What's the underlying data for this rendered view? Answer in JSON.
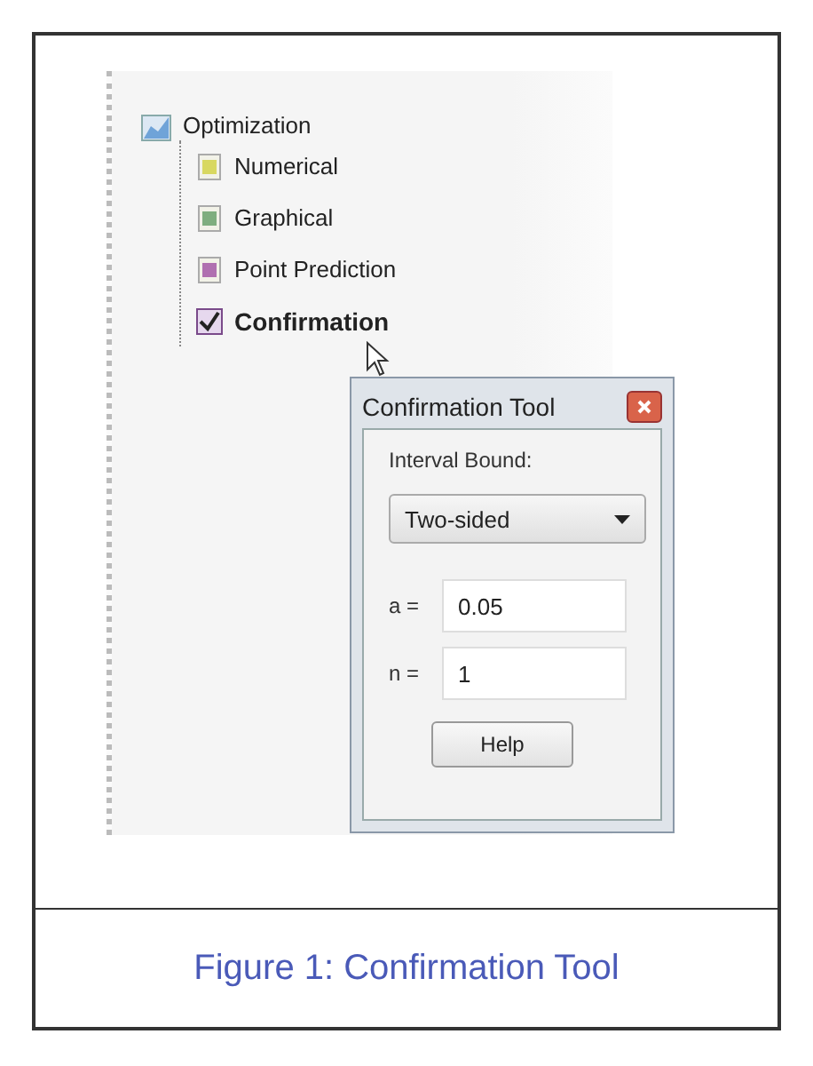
{
  "tree": {
    "items": [
      {
        "label": "Optimization",
        "selected": false,
        "children": [
          {
            "label": "Numerical",
            "kind": "document",
            "selected": false
          },
          {
            "label": "Graphical",
            "kind": "document",
            "selected": false
          },
          {
            "label": "Point Prediction",
            "kind": "document",
            "selected": false
          },
          {
            "label": "Confirmation",
            "kind": "checkbox",
            "selected": true
          }
        ]
      }
    ]
  },
  "dialog": {
    "title": "Confirmation Tool",
    "interval_label": "Interval Bound:",
    "dropdown": {
      "value": "Two-sided"
    },
    "fields": [
      {
        "label": "a =",
        "value": "0.05"
      },
      {
        "label": "n =",
        "value": "1"
      }
    ],
    "button": "Help"
  },
  "caption": "Figure 1: Confirmation Tool"
}
